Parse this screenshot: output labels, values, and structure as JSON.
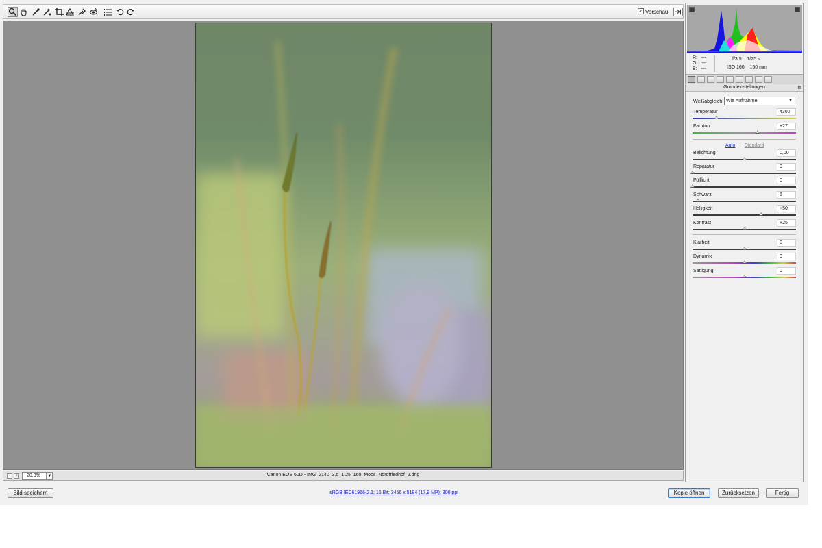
{
  "toolbar": {
    "tools": [
      {
        "icon": "zoom-icon"
      },
      {
        "icon": "hand-icon"
      },
      {
        "icon": "white-balance-eyedropper-icon"
      },
      {
        "icon": "color-sampler-icon"
      },
      {
        "icon": "crop-icon"
      },
      {
        "icon": "straighten-icon"
      },
      {
        "icon": "spot-removal-icon"
      },
      {
        "icon": "red-eye-icon"
      },
      {
        "icon": "preferences-list-icon"
      },
      {
        "icon": "rotate-left-icon"
      },
      {
        "icon": "rotate-right-icon"
      }
    ],
    "preview_label": "Vorschau",
    "preview_checked": true,
    "fullscreen_icon": "fullscreen-toggle-icon"
  },
  "status": {
    "zoom_out": "-",
    "zoom_in": "+",
    "zoom": "20,3%",
    "filename": "Canon EOS 60D - IMG_2140_3.5_1.25_160_Moos_Nordfriedhof_2.dng"
  },
  "info": {
    "r_label": "R:",
    "r_value": "---",
    "g_label": "G:",
    "g_value": "---",
    "b_label": "B:",
    "b_value": "---",
    "aperture": "f/3,5",
    "shutter": "1/25 s",
    "iso": "ISO 160",
    "focal": "150 mm"
  },
  "panel": {
    "section_title": "Grundeinstellungen",
    "white_balance_label": "Weißabgleich:",
    "white_balance_value": "Wie Aufnahme",
    "auto_label": "Auto",
    "standard_label": "Standard",
    "sliders": [
      {
        "label": "Temperatur",
        "value": "4300",
        "position": 0.23,
        "track": "temperature"
      },
      {
        "label": "Farbton",
        "value": "+27",
        "position": 0.63,
        "track": "tint"
      },
      {
        "label": "Belichtung",
        "value": "0,00",
        "position": 0.5,
        "track": "dark"
      },
      {
        "label": "Reparatur",
        "value": "0",
        "position": 0.0,
        "track": "dark"
      },
      {
        "label": "Fülllicht",
        "value": "0",
        "position": 0.0,
        "track": "dark"
      },
      {
        "label": "Schwarz",
        "value": "5",
        "position": 0.05,
        "track": "dark"
      },
      {
        "label": "Helligkeit",
        "value": "+50",
        "position": 0.66,
        "track": "dark"
      },
      {
        "label": "Kontrast",
        "value": "+25",
        "position": 0.5,
        "track": "dark"
      },
      {
        "label": "Klarheit",
        "value": "0",
        "position": 0.5,
        "track": "dark"
      },
      {
        "label": "Dynamik",
        "value": "0",
        "position": 0.5,
        "track": "rainbow"
      },
      {
        "label": "Sättigung",
        "value": "0",
        "position": 0.5,
        "track": "rainbow"
      }
    ]
  },
  "bottom": {
    "save_label": "Bild speichern",
    "workflow_info": "sRGB IEC61966-2.1; 16 Bit; 3456 x 5184 (17,9 MP); 300 ppi",
    "open_copy_label": "Kopie öffnen",
    "reset_label": "Zurücksetzen",
    "done_label": "Fertig"
  },
  "colors": {
    "accent": "#1b3cc7",
    "histogram_bg": "#a7a7a7",
    "viewport_bg": "#909090"
  }
}
